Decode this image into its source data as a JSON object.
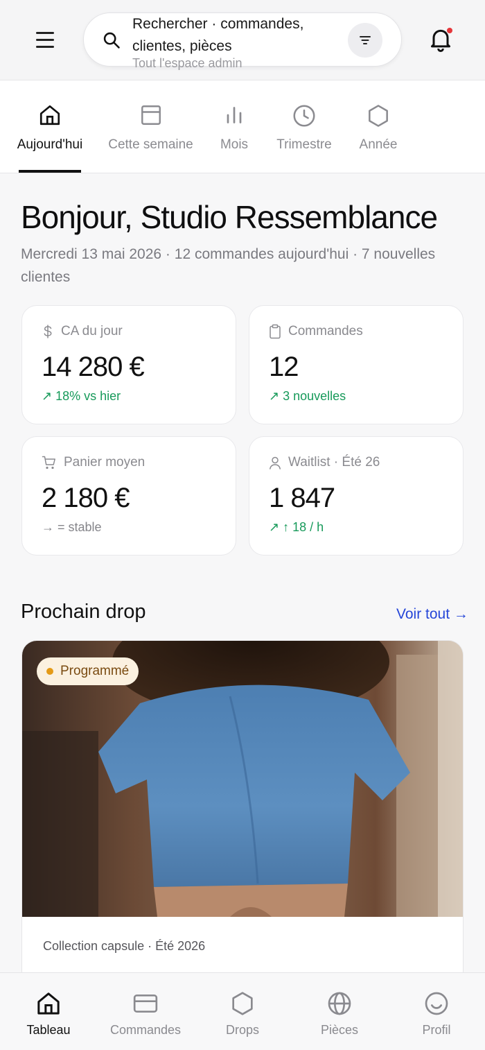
{
  "header": {
    "search_text": "Rechercher · commandes, clientes, pièces",
    "search_scope": "Tout l'espace admin"
  },
  "tabs": [
    {
      "label": "Aujourd'hui",
      "icon": "home-icon",
      "active": true
    },
    {
      "label": "Cette semaine",
      "icon": "calendar-icon",
      "active": false
    },
    {
      "label": "Mois",
      "icon": "bar-chart-icon",
      "active": false
    },
    {
      "label": "Trimestre",
      "icon": "clock-icon",
      "active": false
    },
    {
      "label": "Année",
      "icon": "hexagon-icon",
      "active": false
    }
  ],
  "greeting": {
    "title": "Bonjour, Studio Ressemblance",
    "subtitle": "Mercredi 13 mai 2026 · 12 commandes aujourd'hui · 7 nouvelles clientes"
  },
  "stats": [
    {
      "label": "CA du jour",
      "value": "14 280 €",
      "delta": "↗ 18% vs hier",
      "icon": "dollar-icon"
    },
    {
      "label": "Commandes",
      "value": "12",
      "delta": "↗ 3 nouvelles",
      "icon": "clipboard-icon"
    },
    {
      "label": "Panier moyen",
      "value": "2 180 €",
      "delta": "→ = stable",
      "icon": "cart-icon"
    },
    {
      "label": "Waitlist · Été 26",
      "value": "1 847",
      "delta": "↗ ↑ 18 / h",
      "icon": "user-icon"
    }
  ],
  "drop_section": {
    "title": "Prochain drop",
    "link": "Voir tout →",
    "badge": "Programmé",
    "collection": "Collection capsule · Été 2026"
  },
  "bottom_nav": [
    {
      "label": "Tableau",
      "icon": "home-icon",
      "active": true
    },
    {
      "label": "Commandes",
      "icon": "card-icon",
      "active": false
    },
    {
      "label": "Drops",
      "icon": "hexagon-icon",
      "active": false
    },
    {
      "label": "Pièces",
      "icon": "globe-icon",
      "active": false
    },
    {
      "label": "Profil",
      "icon": "smiley-icon",
      "active": false
    }
  ],
  "colors": {
    "accent_link": "#2546d8",
    "positive": "#179a5a",
    "badge_bg": "#fbf1e0",
    "badge_dot": "#e49a16",
    "notification_dot": "#e5363a"
  }
}
